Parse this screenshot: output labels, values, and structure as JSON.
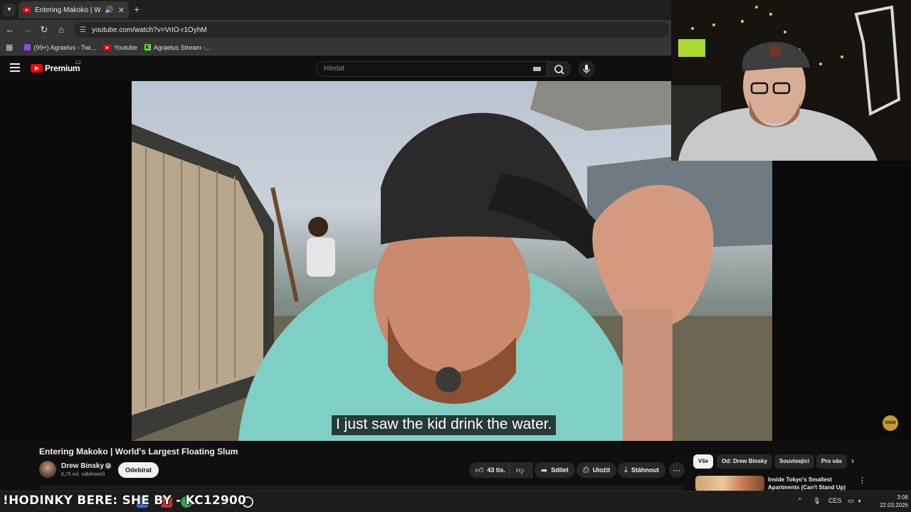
{
  "browser": {
    "tab_title": "Entering Makoko | World's Largest Floating Slum - YouTube",
    "url": "youtube.com/watch?v=VrIO-r1OyhM",
    "bookmarks": [
      {
        "label": "(99+) Agraelus - Twi..."
      },
      {
        "label": "Youtube"
      },
      {
        "label": "Agraelus Stream -..."
      }
    ]
  },
  "youtube": {
    "logo_text": "Premium",
    "country": "CZ",
    "search_placeholder": "Hledat",
    "video": {
      "subtitle": "I just saw the kid drink the water.",
      "watermark": "DREW BINSKY",
      "title": "Entering Makoko | World's Largest Floating Slum"
    },
    "channel": {
      "name": "Drew Binsky",
      "subscribers": "6,75 mil. odběratelů",
      "subscribe_label": "Odebírat"
    },
    "actions": {
      "likes": "43 tis.",
      "share": "Sdílet",
      "save": "Uložit",
      "download": "Stáhnout"
    },
    "chips": [
      "Vše",
      "Od: Drew Binsky",
      "Související",
      "Pro vás"
    ],
    "recommendation": {
      "title": "Inside Tokyo's Smallest Apartments (Can't Stand Up)"
    }
  },
  "taskbar": {
    "ticker": "!HODINKY BERE: SHE BY - KC12900",
    "language": "CES",
    "time": "3:08",
    "date": "22.03.2026"
  },
  "colors": {
    "youtube_red": "#ff0000",
    "chrome_dark": "#353535",
    "page_bg": "#0f0f0f",
    "twitch": "#9146ff",
    "kick": "#53fc18"
  }
}
